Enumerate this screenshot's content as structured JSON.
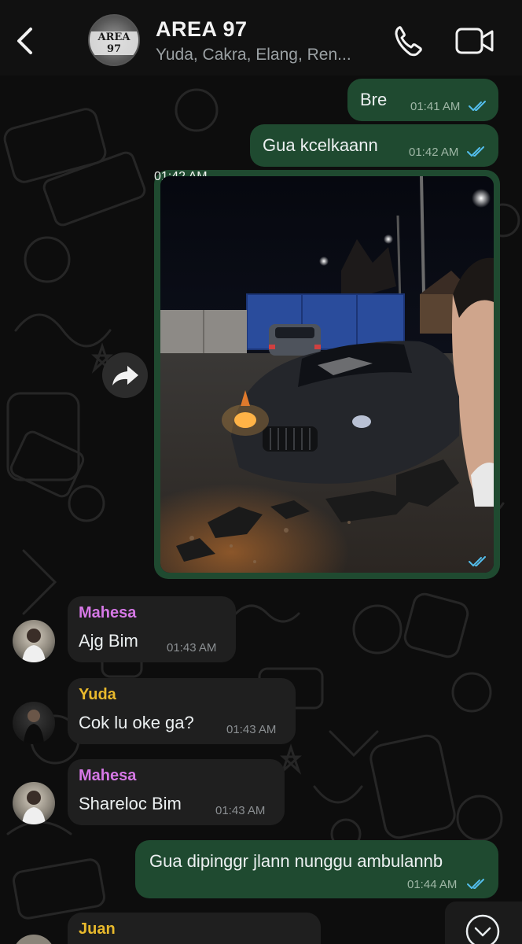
{
  "header": {
    "title": "AREA 97",
    "subtitle": "Yuda, Cakra, Elang, Ren...",
    "avatar_text": "AREA 97"
  },
  "messages": [
    {
      "type": "outgoing",
      "text": "Bre",
      "time": "01:41 AM",
      "status": "read"
    },
    {
      "type": "outgoing",
      "text": "Gua kcelkaann",
      "time": "01:42 AM",
      "status": "read"
    },
    {
      "type": "outgoing-image",
      "time": "01:42 AM",
      "status": "read"
    },
    {
      "type": "incoming",
      "sender": "Mahesa",
      "text": "Ajg Bim",
      "time": "01:43 AM"
    },
    {
      "type": "incoming",
      "sender": "Yuda",
      "text": "Cok lu oke ga?",
      "time": "01:43 AM"
    },
    {
      "type": "incoming",
      "sender": "Mahesa",
      "text": "Shareloc Bim",
      "time": "01:43 AM"
    },
    {
      "type": "outgoing",
      "text": "Gua dipinggr jlann nunggu ambulannb",
      "time": "01:44 AM",
      "status": "read"
    },
    {
      "type": "incoming",
      "sender": "Juan",
      "text": "",
      "time": ""
    }
  ],
  "colors": {
    "outgoing_bubble": "#1f4a30",
    "incoming_bubble": "#1f1f1f",
    "read_ticks": "#53bdeb",
    "sender_mahesa": "#d678e6",
    "sender_yuda": "#e8b92c",
    "sender_juan": "#e8b92c"
  },
  "icons": [
    "back-chevron-icon",
    "phone-icon",
    "video-camera-icon",
    "forward-icon",
    "chevron-down-icon",
    "double-check-icon"
  ]
}
